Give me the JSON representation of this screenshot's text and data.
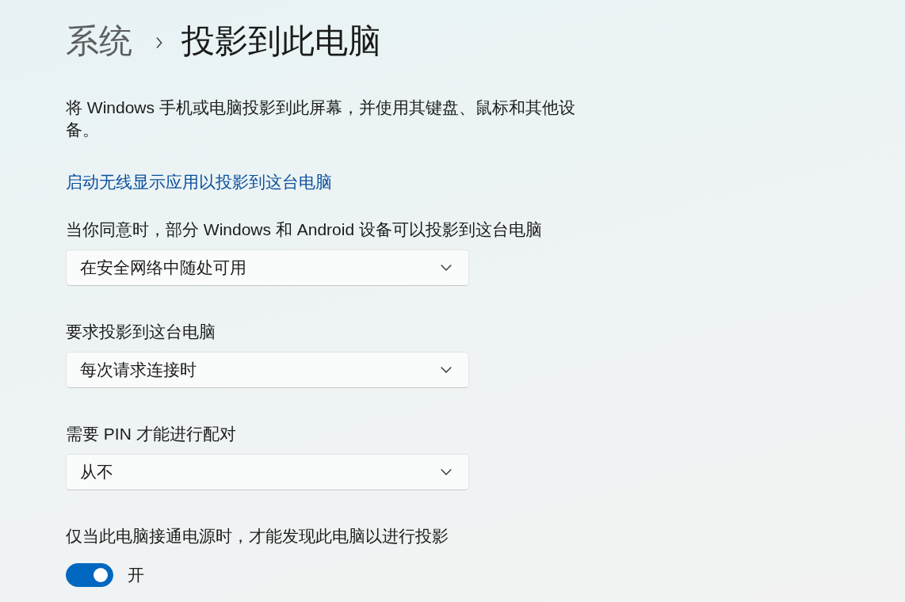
{
  "breadcrumb": {
    "parent": "系统",
    "current": "投影到此电脑"
  },
  "description": "将 Windows 手机或电脑投影到此屏幕，并使用其键盘、鼠标和其他设备。",
  "link": "启动无线显示应用以投影到这台电脑",
  "settings": [
    {
      "kind": "dropdown",
      "label": "当你同意时，部分 Windows 和 Android 设备可以投影到这台电脑",
      "value": "在安全网络中随处可用"
    },
    {
      "kind": "dropdown",
      "label": "要求投影到这台电脑",
      "value": "每次请求连接时"
    },
    {
      "kind": "dropdown",
      "label": "需要 PIN 才能进行配对",
      "value": "从不"
    },
    {
      "kind": "toggle",
      "label": "仅当此电脑接通电源时，才能发现此电脑以进行投影",
      "on": true,
      "state_label": "开"
    }
  ]
}
